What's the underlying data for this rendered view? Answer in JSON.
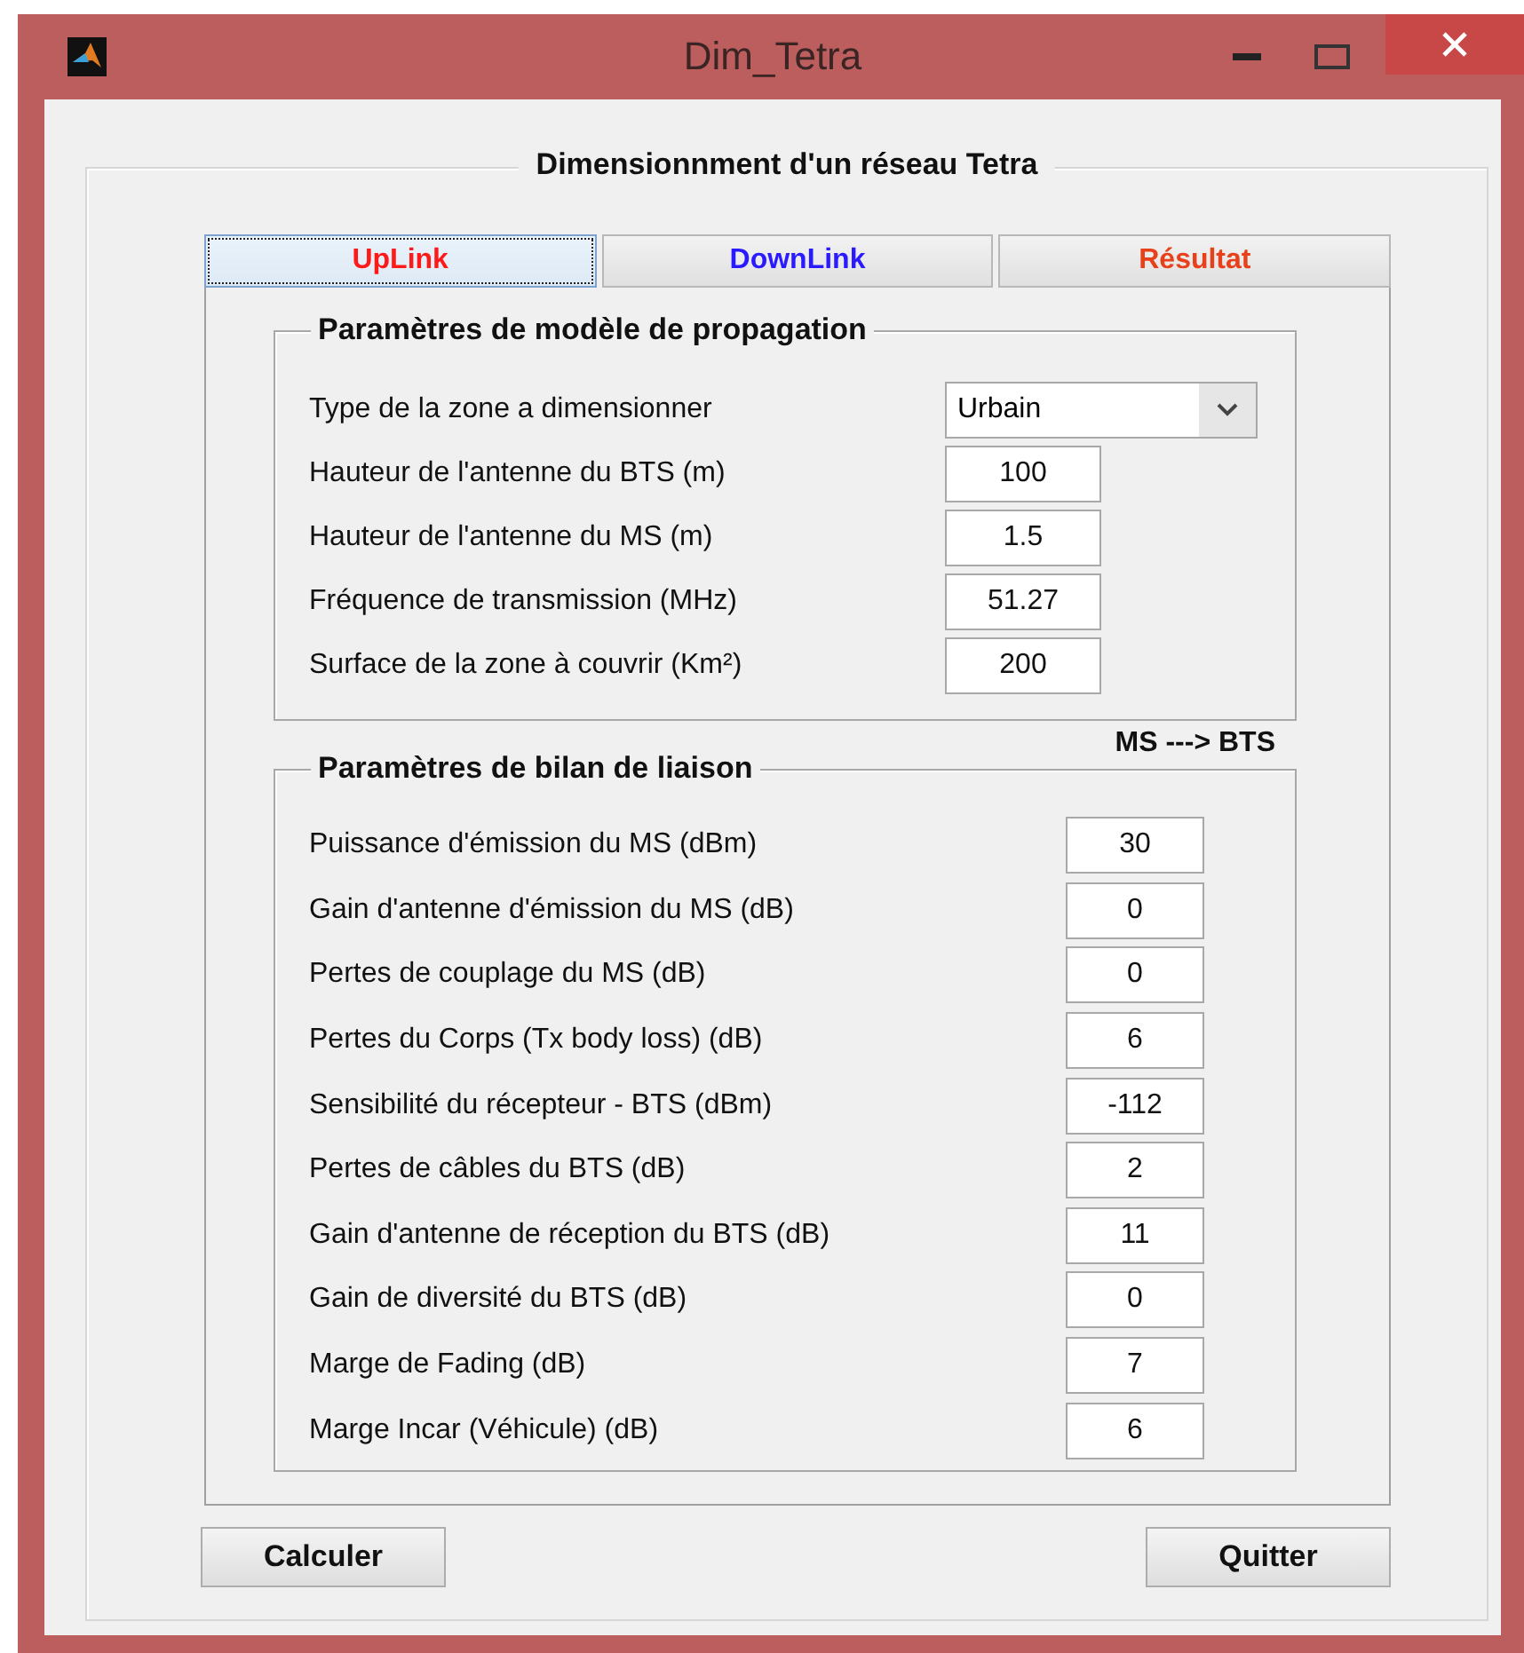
{
  "window": {
    "title": "Dim_Tetra"
  },
  "panel": {
    "title": "Dimensionnment d'un réseau Tetra"
  },
  "tabs": [
    {
      "label": "UpLink",
      "selected": true,
      "color": "#ff1a1a"
    },
    {
      "label": "DownLink",
      "selected": false,
      "color": "#2a1aff"
    },
    {
      "label": "Résultat",
      "selected": false,
      "color": "#e8401a"
    }
  ],
  "propagation": {
    "title": "Paramètres de modèle de propagation",
    "fields": [
      {
        "kind": "select",
        "label": "Type de la zone a dimensionner",
        "value": "Urbain"
      },
      {
        "kind": "input",
        "label": "Hauteur de l'antenne du BTS (m)",
        "value": "100"
      },
      {
        "kind": "input",
        "label": "Hauteur de l'antenne du MS (m)",
        "value": "1.5"
      },
      {
        "kind": "input",
        "label": "Fréquence de transmission (MHz)",
        "value": "51.27"
      },
      {
        "kind": "input",
        "label": "Surface de la zone à couvrir (Km²)",
        "value": "200"
      }
    ]
  },
  "direction": "MS ---> BTS",
  "link_budget": {
    "title": "Paramètres de bilan de liaison",
    "fields": [
      {
        "label": "Puissance d'émission du MS (dBm)",
        "value": "30"
      },
      {
        "label": "Gain d'antenne d'émission du MS (dB)",
        "value": "0"
      },
      {
        "label": "Pertes de couplage du MS (dB)",
        "value": "0"
      },
      {
        "label": "Pertes du Corps (Tx body loss) (dB)",
        "value": "6"
      },
      {
        "label": "Sensibilité du récepteur - BTS (dBm)",
        "value": "-112"
      },
      {
        "label": "Pertes de câbles du BTS (dB)",
        "value": "2"
      },
      {
        "label": "Gain d'antenne de réception du BTS (dB)",
        "value": "11"
      },
      {
        "label": "Gain de diversité du BTS (dB)",
        "value": "0"
      },
      {
        "label": "Marge de Fading (dB)",
        "value": "7"
      },
      {
        "label": "Marge Incar (Véhicule) (dB)",
        "value": "6"
      }
    ]
  },
  "buttons": [
    "Calculer",
    "Quitter"
  ]
}
